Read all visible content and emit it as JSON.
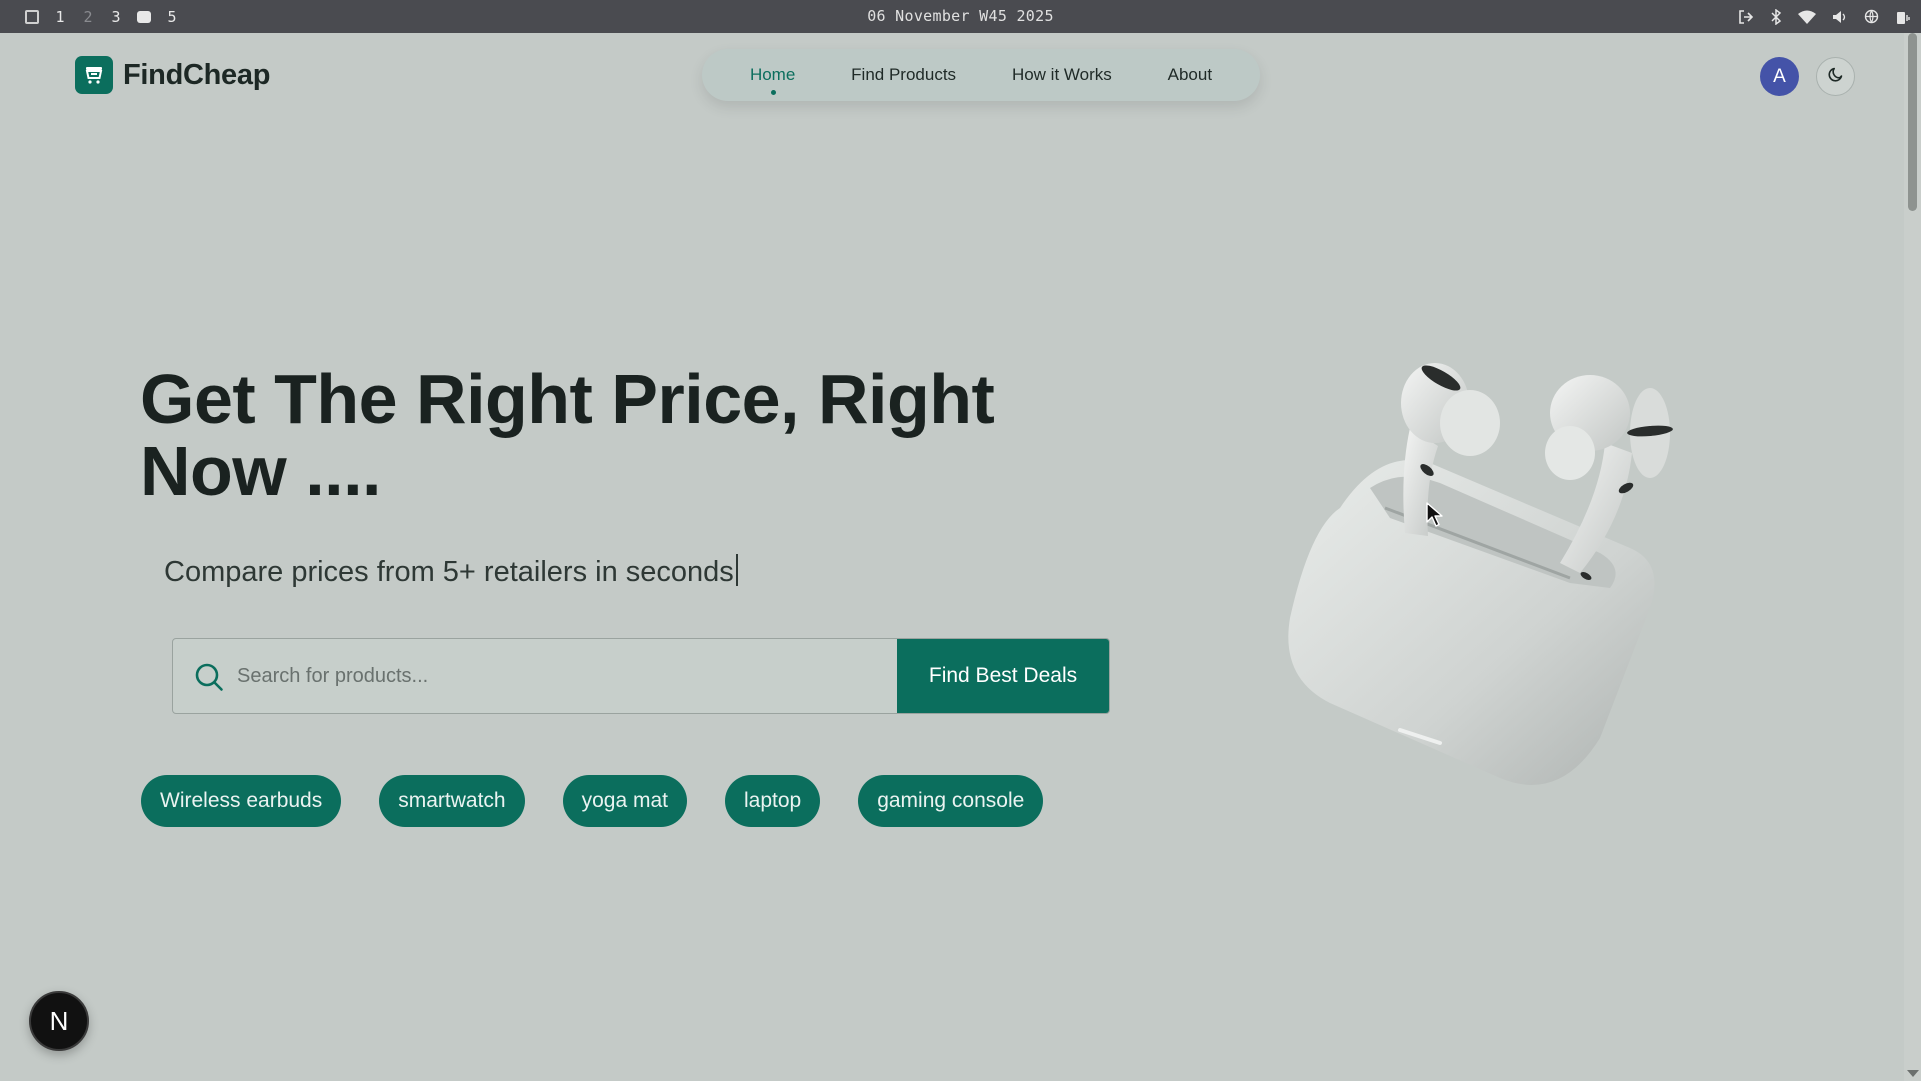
{
  "os_bar": {
    "workspaces": [
      "1",
      "2",
      "3",
      "5"
    ],
    "date": "06 November W45 2025",
    "icons": [
      "logout-icon",
      "bluetooth-icon",
      "wifi-icon",
      "volume-icon",
      "network-icon",
      "battery-icon"
    ]
  },
  "header": {
    "brand": "FindCheap",
    "nav": [
      {
        "label": "Home",
        "active": true
      },
      {
        "label": "Find Products",
        "active": false
      },
      {
        "label": "How it Works",
        "active": false
      },
      {
        "label": "About",
        "active": false
      }
    ],
    "avatar_initial": "A"
  },
  "hero": {
    "title": "Get The Right Price, Right Now ....",
    "subtitle": "Compare prices from 5+ retailers in seconds",
    "search": {
      "placeholder": "Search for products...",
      "value": "",
      "button_label": "Find Best Deals"
    },
    "chips": [
      "Wireless earbuds",
      "smartwatch",
      "yoga mat",
      "laptop",
      "gaming console"
    ]
  },
  "dev_badge": "N",
  "colors": {
    "brand": "#0b6e5d",
    "background": "#c4cac7",
    "avatar": "#4453a8"
  }
}
